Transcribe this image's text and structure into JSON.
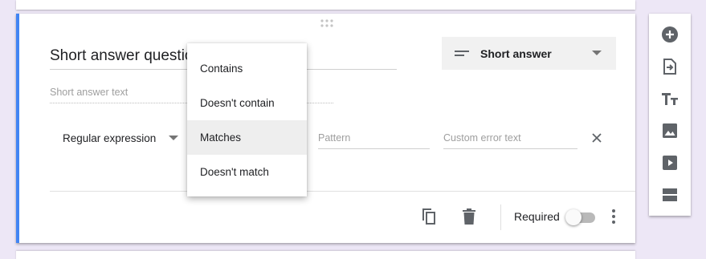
{
  "question": {
    "title": "Short answer question",
    "answer_placeholder": "Short answer text"
  },
  "type_select": {
    "label": "Short answer",
    "icon": "short-answer-lines-icon"
  },
  "validation": {
    "type_label": "Regular expression",
    "pattern_placeholder": "Pattern",
    "error_placeholder": "Custom error text"
  },
  "dropdown": {
    "items": [
      {
        "label": "Contains",
        "selected": false
      },
      {
        "label": "Doesn't contain",
        "selected": false
      },
      {
        "label": "Matches",
        "selected": true
      },
      {
        "label": "Doesn't match",
        "selected": false
      }
    ]
  },
  "footer": {
    "required_label": "Required",
    "required_on": false
  },
  "side_toolbar": {
    "tools": [
      "add-question-icon",
      "import-questions-icon",
      "add-title-icon",
      "add-image-icon",
      "add-video-icon",
      "add-section-icon"
    ]
  },
  "colors": {
    "accent": "#4285f4",
    "background": "#ede7f6",
    "icon": "#5f6368"
  }
}
